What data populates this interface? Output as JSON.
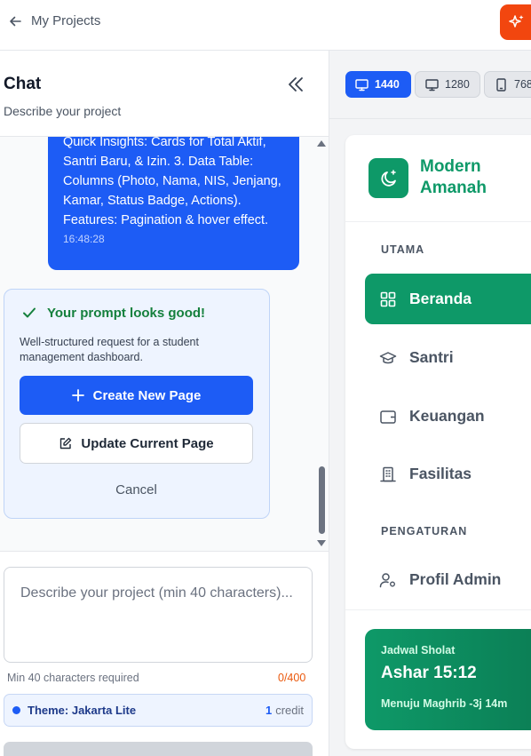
{
  "header": {
    "back_label": "My Projects"
  },
  "chat": {
    "title": "Chat",
    "subtitle": "Describe your project",
    "message": {
      "text": "Quick Insights: Cards for Total Aktif, Santri Baru, & Izin. 3. Data Table: Columns (Photo, Nama, NIS, Jenjang, Kamar, Status Badge, Actions). Features: Pagination & hover effect.",
      "time": "16:48:28"
    },
    "result": {
      "status": "Your prompt looks good!",
      "description": "Well-structured request for a student management dashboard.",
      "create_label": "Create New Page",
      "update_label": "Update Current Page",
      "cancel_label": "Cancel"
    },
    "composer": {
      "placeholder": "Describe your project (min 40 characters)...",
      "min_note": "Min 40 characters required",
      "counter": "0/400",
      "theme_label": "Theme: Jakarta Lite",
      "credit_count": "1",
      "credit_label": "credit"
    }
  },
  "preview": {
    "viewports": [
      {
        "label": "1440",
        "icon": "monitor-icon",
        "active": true
      },
      {
        "label": "1280",
        "icon": "monitor-icon",
        "active": false
      },
      {
        "label": "768",
        "icon": "tablet-icon",
        "active": false
      }
    ],
    "app": {
      "brand_name": "Modern Amanah",
      "section_main": "UTAMA",
      "section_settings": "PENGATURAN",
      "nav": [
        "Beranda",
        "Santri",
        "Keuangan",
        "Fasilitas",
        "Profil Admin"
      ],
      "prayer": {
        "label": "Jadwal Sholat",
        "time": "Ashar 15:12",
        "next": "Menuju Maghrib -3j 14m"
      }
    }
  },
  "colors": {
    "primary_blue": "#1d5cf5",
    "brand_green": "#0e9968",
    "accent_orange": "#f2460f",
    "success_green": "#15803d"
  }
}
